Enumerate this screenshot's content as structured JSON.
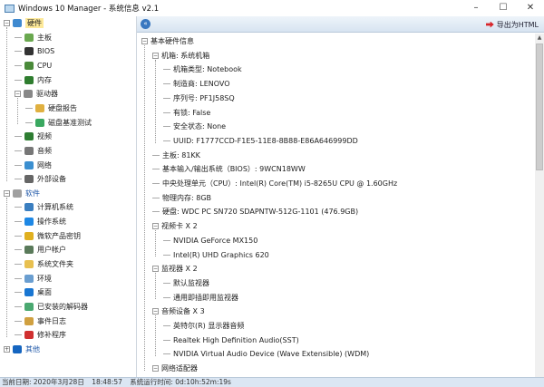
{
  "window": {
    "title": "Windows 10 Manager - 系统信息 v2.1",
    "minimize": "–",
    "maximize": "☐",
    "close": "✕"
  },
  "toolbar": {
    "collapse_icon": "«",
    "export_label": "导出为HTML"
  },
  "tree": [
    {
      "label": "硬件",
      "expander": "⊟",
      "selected": true,
      "icon_color": "#3f8ad0",
      "children": [
        {
          "label": "主板",
          "icon_color": "#6aa84f"
        },
        {
          "label": "BIOS",
          "icon_color": "#333333"
        },
        {
          "label": "CPU",
          "icon_color": "#4a8a3a"
        },
        {
          "label": "内存",
          "icon_color": "#2f7d2f"
        },
        {
          "label": "驱动器",
          "expander": "⊟",
          "icon_color": "#888888",
          "children": [
            {
              "label": "硬盘报告",
              "icon_color": "#e0b040"
            },
            {
              "label": "磁盘基准测试",
              "icon_color": "#3aa860"
            }
          ]
        },
        {
          "label": "视频",
          "icon_color": "#2e7d32"
        },
        {
          "label": "音频",
          "icon_color": "#777777"
        },
        {
          "label": "网络",
          "icon_color": "#3b8fd0"
        },
        {
          "label": "外部设备",
          "icon_color": "#666666"
        }
      ]
    },
    {
      "label": "软件",
      "expander": "⊟",
      "icon_color": "#a0a0a0",
      "children": [
        {
          "label": "计算机系统",
          "icon_color": "#3b7fc0"
        },
        {
          "label": "操作系统",
          "icon_color": "#1e88e5"
        },
        {
          "label": "微软产品密钥",
          "icon_color": "#e0b020"
        },
        {
          "label": "用户帐户",
          "icon_color": "#5a7a5a"
        },
        {
          "label": "系统文件夹",
          "icon_color": "#e8c050"
        },
        {
          "label": "环境",
          "icon_color": "#6a9ed0"
        },
        {
          "label": "桌面",
          "icon_color": "#1976d2"
        },
        {
          "label": "已安装的解码器",
          "icon_color": "#4aa870"
        },
        {
          "label": "事件日志",
          "icon_color": "#d0a040"
        },
        {
          "label": "修补程序",
          "icon_color": "#d03030"
        }
      ]
    },
    {
      "label": "其他",
      "expander": "⊞",
      "icon_color": "#1565c0",
      "children": []
    }
  ],
  "info": [
    {
      "label": "基本硬件信息",
      "expander": "⊟",
      "children": [
        {
          "label": "机箱: 系统机箱",
          "expander": "⊟",
          "children": [
            {
              "label": "机箱类型: Notebook"
            },
            {
              "label": "制造商: LENOVO"
            },
            {
              "label": "序列号: PF1J58SQ"
            },
            {
              "label": "有锁: False"
            },
            {
              "label": "安全状态: None"
            },
            {
              "label": "UUID: F1777CCD-F1E5-11E8-8B88-E86A646999DD"
            }
          ]
        },
        {
          "label": "主板: 81KK"
        },
        {
          "label": "基本输入/输出系统（BIOS）: 9WCN18WW"
        },
        {
          "label": "中央处理单元（CPU）: Intel(R) Core(TM) i5-8265U CPU @ 1.60GHz"
        },
        {
          "label": "物理内存: 8GB"
        },
        {
          "label": "硬盘: WDC PC SN720 SDAPNTW-512G-1101 (476.9GB)"
        },
        {
          "label": "视频卡 X 2",
          "expander": "⊟",
          "children": [
            {
              "label": "NVIDIA GeForce MX150"
            },
            {
              "label": "Intel(R) UHD Graphics 620"
            }
          ]
        },
        {
          "label": "监视器 X 2",
          "expander": "⊟",
          "children": [
            {
              "label": "默认监视器"
            },
            {
              "label": "通用即插即用监视器"
            }
          ]
        },
        {
          "label": "音频设备 X 3",
          "expander": "⊟",
          "children": [
            {
              "label": "英特尔(R) 显示器音频"
            },
            {
              "label": "Realtek High Definition Audio(SST)"
            },
            {
              "label": "NVIDIA Virtual Audio Device (Wave Extensible) (WDM)"
            }
          ]
        },
        {
          "label": "网络适配器",
          "expander": "⊟",
          "children": []
        }
      ]
    }
  ],
  "status": {
    "date": "当前日期: 2020年3月28日",
    "time": "18:48:57",
    "uptime": "系统运行时间: 0d:10h:52m:19s"
  }
}
